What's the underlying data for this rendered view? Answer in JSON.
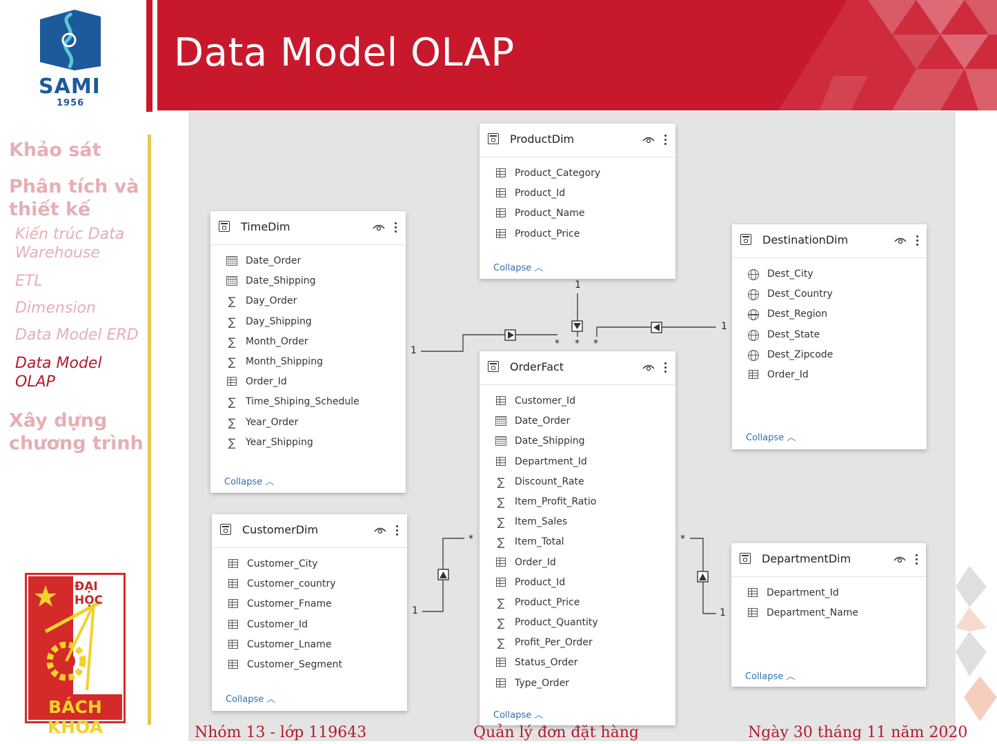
{
  "slide": {
    "title": "Data Model OLAP"
  },
  "logo": {
    "top_text": "SAMI",
    "top_year": "1956",
    "bottom_text_top": "ĐẠI HỌC",
    "bottom_text_bottom": "BÁCH KHOA"
  },
  "nav": {
    "sections": [
      {
        "label": "Khảo sát"
      },
      {
        "label": "Phân tích và thiết kế"
      },
      {
        "label": "Xây dựng chương trình"
      }
    ],
    "subitems": [
      {
        "label": "Kiến trúc Data Warehouse",
        "active": false
      },
      {
        "label": "ETL",
        "active": false
      },
      {
        "label": "Dimension",
        "active": false
      },
      {
        "label": "Data Model ERD",
        "active": false
      },
      {
        "label": "Data Model OLAP",
        "active": true
      }
    ]
  },
  "diagram": {
    "collapse_label": "Collapse",
    "tables": {
      "product": {
        "name": "ProductDim",
        "fields": [
          {
            "name": "Product_Category",
            "icon": "table-icon"
          },
          {
            "name": "Product_Id",
            "icon": "table-icon"
          },
          {
            "name": "Product_Name",
            "icon": "table-icon"
          },
          {
            "name": "Product_Price",
            "icon": "table-icon"
          }
        ]
      },
      "time": {
        "name": "TimeDim",
        "fields": [
          {
            "name": "Date_Order",
            "icon": "calendar-icon"
          },
          {
            "name": "Date_Shipping",
            "icon": "calendar-icon"
          },
          {
            "name": "Day_Order",
            "icon": "sigma-icon"
          },
          {
            "name": "Day_Shipping",
            "icon": "sigma-icon"
          },
          {
            "name": "Month_Order",
            "icon": "sigma-icon"
          },
          {
            "name": "Month_Shipping",
            "icon": "sigma-icon"
          },
          {
            "name": "Order_Id",
            "icon": "table-icon"
          },
          {
            "name": "Time_Shiping_Schedule",
            "icon": "sigma-icon"
          },
          {
            "name": "Year_Order",
            "icon": "sigma-icon"
          },
          {
            "name": "Year_Shipping",
            "icon": "sigma-icon"
          }
        ]
      },
      "destination": {
        "name": "DestinationDim",
        "fields": [
          {
            "name": "Dest_City",
            "icon": "globe-icon"
          },
          {
            "name": "Dest_Country",
            "icon": "globe-icon"
          },
          {
            "name": "Dest_Region",
            "icon": "globe-icon"
          },
          {
            "name": "Dest_State",
            "icon": "globe-icon"
          },
          {
            "name": "Dest_Zipcode",
            "icon": "globe-icon"
          },
          {
            "name": "Order_Id",
            "icon": "table-icon"
          }
        ]
      },
      "order": {
        "name": "OrderFact",
        "fields": [
          {
            "name": "Customer_Id",
            "icon": "table-icon"
          },
          {
            "name": "Date_Order",
            "icon": "calendar-icon"
          },
          {
            "name": "Date_Shipping",
            "icon": "calendar-icon"
          },
          {
            "name": "Department_Id",
            "icon": "table-icon"
          },
          {
            "name": "Discount_Rate",
            "icon": "sigma-icon"
          },
          {
            "name": "Item_Profit_Ratio",
            "icon": "sigma-icon"
          },
          {
            "name": "Item_Sales",
            "icon": "sigma-icon"
          },
          {
            "name": "Item_Total",
            "icon": "sigma-icon"
          },
          {
            "name": "Order_Id",
            "icon": "table-icon"
          },
          {
            "name": "Product_Id",
            "icon": "table-icon"
          },
          {
            "name": "Product_Price",
            "icon": "sigma-icon"
          },
          {
            "name": "Product_Quantity",
            "icon": "sigma-icon"
          },
          {
            "name": "Profit_Per_Order",
            "icon": "sigma-icon"
          },
          {
            "name": "Status_Order",
            "icon": "table-icon"
          },
          {
            "name": "Type_Order",
            "icon": "table-icon"
          }
        ]
      },
      "customer": {
        "name": "CustomerDim",
        "fields": [
          {
            "name": "Customer_City",
            "icon": "table-icon"
          },
          {
            "name": "Customer_country",
            "icon": "table-icon"
          },
          {
            "name": "Customer_Fname",
            "icon": "table-icon"
          },
          {
            "name": "Customer_Id",
            "icon": "table-icon"
          },
          {
            "name": "Customer_Lname",
            "icon": "table-icon"
          },
          {
            "name": "Customer_Segment",
            "icon": "table-icon"
          }
        ]
      },
      "department": {
        "name": "DepartmentDim",
        "fields": [
          {
            "name": "Department_Id",
            "icon": "table-icon"
          },
          {
            "name": "Department_Name",
            "icon": "table-icon"
          }
        ]
      }
    },
    "cardinality": {
      "one": "1",
      "many": "*"
    }
  },
  "footer": {
    "left": "Nhóm 13 - lớp 119643",
    "center": "Quản lý đơn đặt hàng",
    "right": "Ngày 30 tháng 11 năm 2020"
  },
  "colors": {
    "brand_red": "#c8192c",
    "nav_inactive": "#e6aeb5",
    "nav_active": "#b31b2c",
    "nav_bar": "#e6c84a",
    "link_blue": "#2f6fb5",
    "sami_blue": "#1d5a9c"
  }
}
